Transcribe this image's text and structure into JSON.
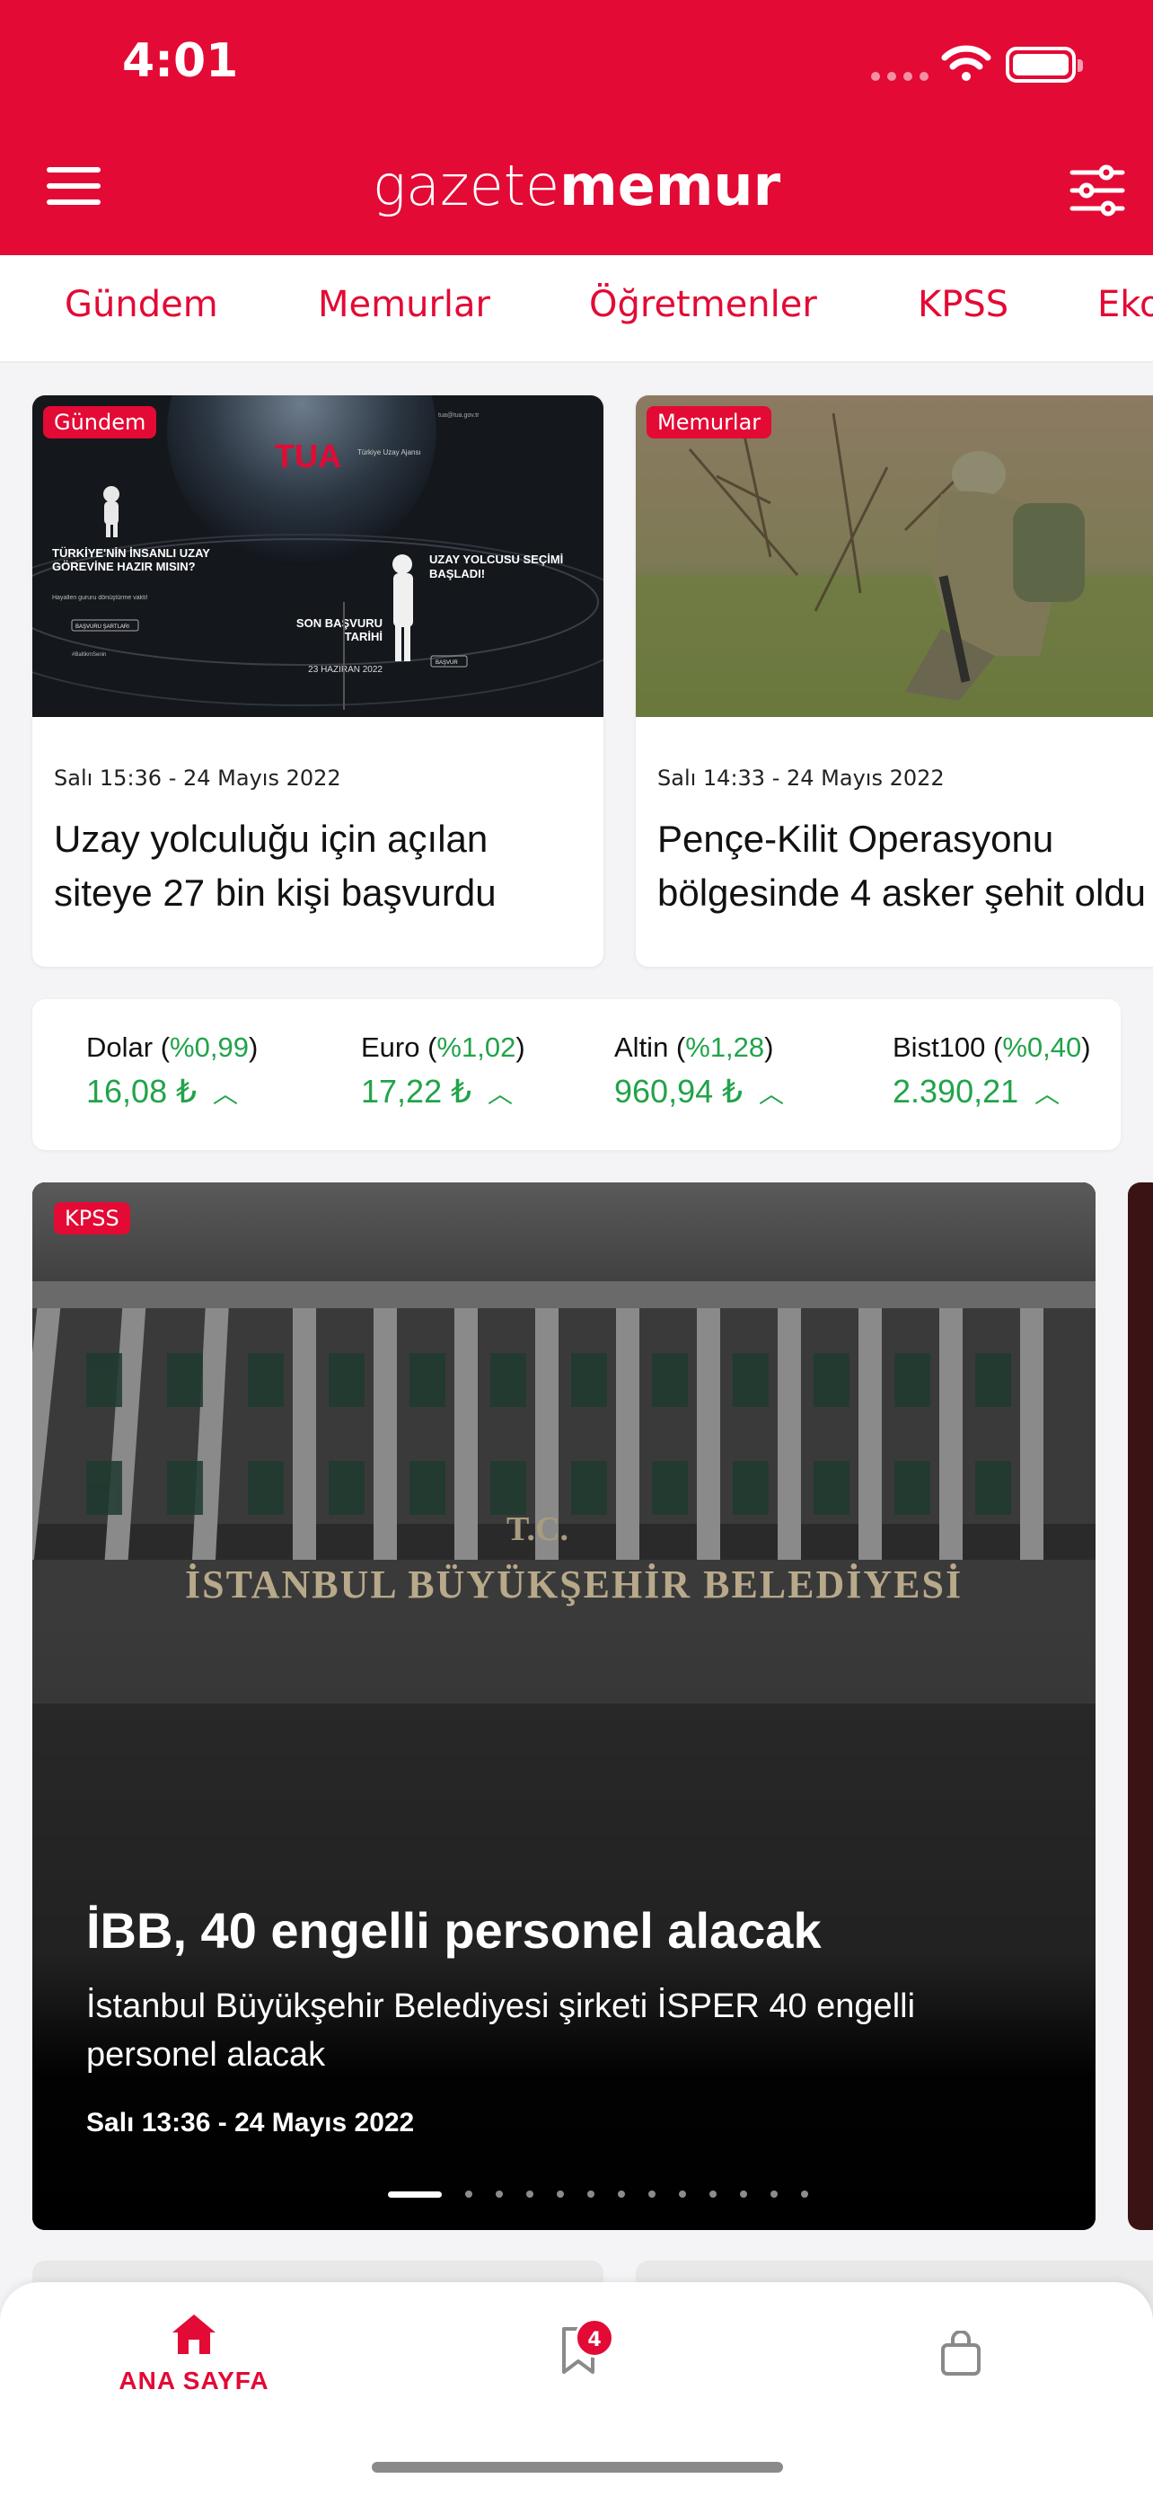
{
  "status_bar": {
    "time": "4:01"
  },
  "header": {
    "logo_light": "gazete",
    "logo_bold": "memur"
  },
  "categories": [
    "Gündem",
    "Memurlar",
    "Öğretmenler",
    "KPSS",
    "Eko"
  ],
  "cards": [
    {
      "badge": "Gündem",
      "meta": "Salı 15:36 - 24 Mayıs 2022",
      "title": "Uzay yolculuğu için açılan siteye 27 bin kişi başvurdu",
      "image": {
        "brand": "TUA",
        "brand_sub": "Türkiye Uzay Ajansı",
        "left_title": "TÜRKİYE'NİN İNSANLI UZAY GÖREVİNE HAZIR MISIN?",
        "left_sub": "Hayalleri gururu dönüştürme vakti!",
        "left_btn": "BAŞVURU ŞARTLARI",
        "hashtag": "#BaltikmSenin",
        "deadline_title": "SON BAŞVURU TARİHİ",
        "deadline_date": "23 HAZİRAN 2022",
        "right_title": "UZAY YOLCUSU SEÇİMİ BAŞLADI!",
        "right_btn": "BAŞVUR",
        "url": "tua@tua.gov.tr"
      }
    },
    {
      "badge": "Memurlar",
      "meta": "Salı 14:33 - 24 Mayıs 2022",
      "title": "Pençe-Kilit Operasyonu bölgesinde 4 asker şehit oldu"
    }
  ],
  "markets": [
    {
      "name": "Dolar",
      "change": "%0,99",
      "value": "16,08 ₺"
    },
    {
      "name": "Euro",
      "change": "%1,02",
      "value": "17,22 ₺"
    },
    {
      "name": "Altin",
      "change": "%1,28",
      "value": "960,94 ₺"
    },
    {
      "name": "Bist100",
      "change": "%0,40",
      "value": "2.390,21"
    }
  ],
  "hero": {
    "badge": "KPSS",
    "sign_tc": "T.C.",
    "sign_name": "İSTANBUL BÜYÜKŞEHİR BELEDİYESİ",
    "title": "İBB, 40 engelli personel alacak",
    "subtitle": "İstanbul Büyükşehir Belediyesi şirketi İSPER 40 engelli personel alacak",
    "date": "Salı 13:36 - 24 Mayıs 2022",
    "slides_total": 13,
    "slide_active": 1
  },
  "tabbar": {
    "home_label": "ANA SAYFA",
    "bookmark_count": "4"
  },
  "colors": {
    "brand_red": "#e30a35",
    "market_green": "#22a34a"
  }
}
